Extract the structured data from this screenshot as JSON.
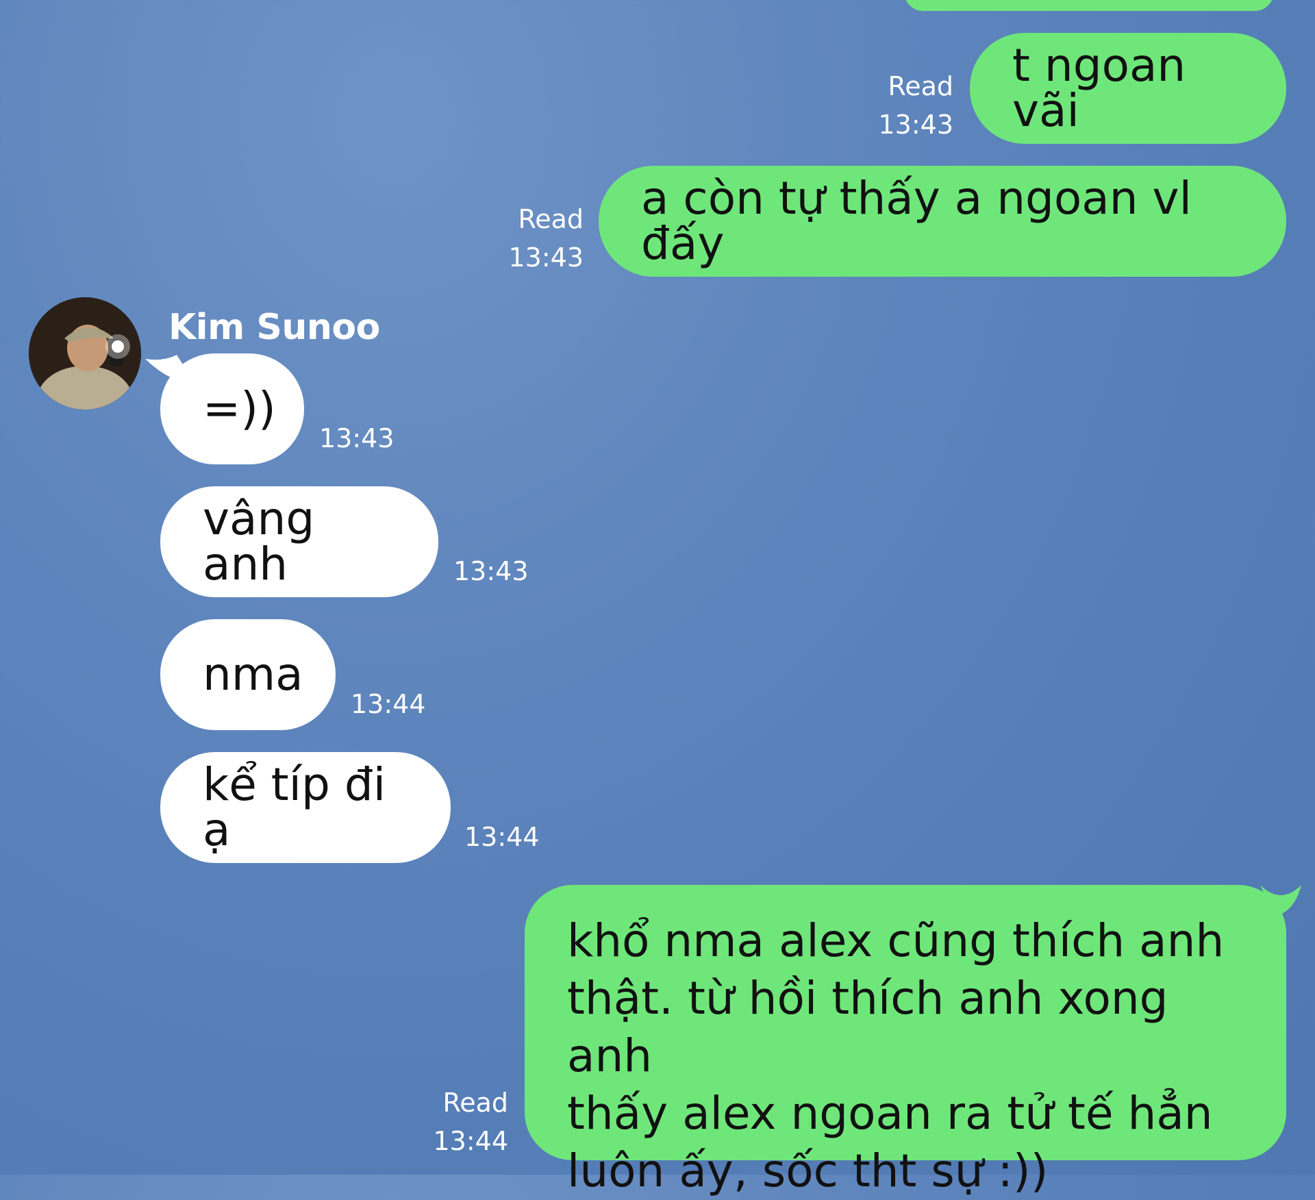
{
  "chat": {
    "contact_name": "Kim Sunoo",
    "messages": [
      {
        "id": "m1",
        "direction": "sent",
        "text": "t ngoan vãi",
        "read_label": "Read",
        "time": "13:43"
      },
      {
        "id": "m2",
        "direction": "sent",
        "text": "a còn tự thấy a ngoan vl đấy",
        "read_label": "Read",
        "time": "13:43"
      },
      {
        "id": "m3",
        "direction": "received",
        "text": "=))",
        "time": "13:43"
      },
      {
        "id": "m4",
        "direction": "received",
        "text": "vâng anh",
        "time": "13:43"
      },
      {
        "id": "m5",
        "direction": "received",
        "text": "nma",
        "time": "13:44"
      },
      {
        "id": "m6",
        "direction": "received",
        "text": "kể típ đi ạ",
        "time": "13:44"
      },
      {
        "id": "m7",
        "direction": "sent",
        "lines": [
          "khổ nma alex cũng thích anh",
          "thật. từ hồi thích anh xong anh",
          "thấy alex ngoan ra tử tế hẳn",
          "luôn ấy, sốc tht sự :))"
        ],
        "read_label": "Read",
        "time": "13:44"
      }
    ]
  },
  "colors": {
    "sent_bubble": "#6fe67a",
    "received_bubble": "#ffffff",
    "background": "#557db6",
    "meta_text": "#ffffff"
  }
}
